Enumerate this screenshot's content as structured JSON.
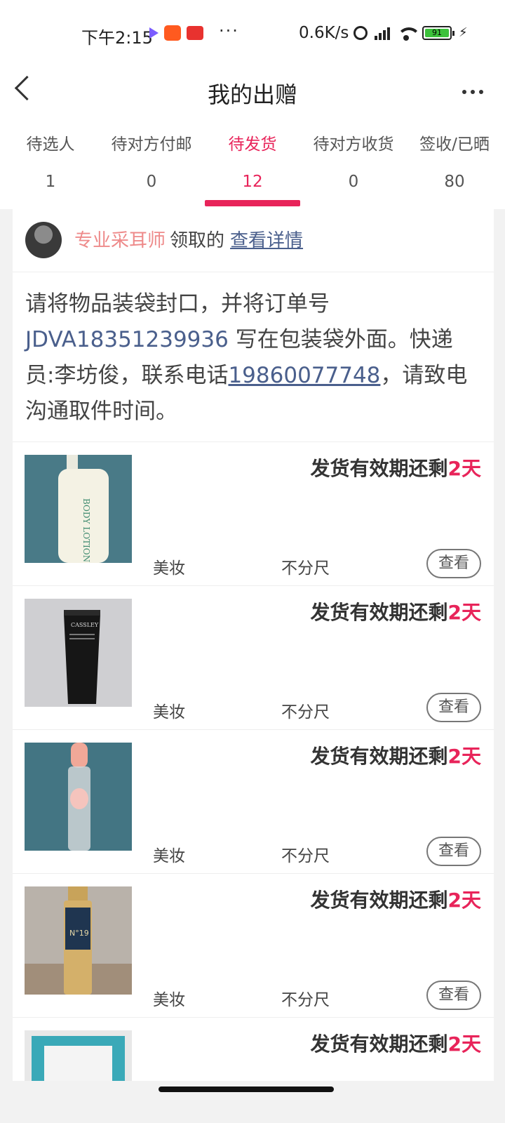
{
  "status_bar": {
    "time": "下午2:15",
    "more": "···",
    "net_speed": "0.6K/s",
    "battery": "91",
    "signal": "HD"
  },
  "nav": {
    "title": "我的出赠"
  },
  "tabs": [
    {
      "label": "待选人",
      "count": "1"
    },
    {
      "label": "待对方付邮",
      "count": "0"
    },
    {
      "label": "待发货",
      "count": "12"
    },
    {
      "label": "待对方收货",
      "count": "0"
    },
    {
      "label": "签收/已晒",
      "count": "80"
    }
  ],
  "active_tab_index": 2,
  "receiver": {
    "name": "专业采耳师",
    "text": "领取的",
    "link": "查看详情"
  },
  "notice": {
    "part1": "请将物品装袋封口，并将订单号 ",
    "order_no": "JDVA18351239936",
    "part2": " 写在包装袋外面。快递员:李坊俊，联系电话",
    "phone": "19860077748",
    "part3": "，请致电沟通取件时间。"
  },
  "items": [
    {
      "deadline_prefix": "发货有效期还剩",
      "days": "2天",
      "category": "美妆",
      "size": "不分尺",
      "button": "查看",
      "image": "body-lotion-bottle"
    },
    {
      "deadline_prefix": "发货有效期还剩",
      "days": "2天",
      "category": "美妆",
      "size": "不分尺",
      "button": "查看",
      "image": "black-hand-cream-tube"
    },
    {
      "deadline_prefix": "发货有效期还剩",
      "days": "2天",
      "category": "美妆",
      "size": "不分尺",
      "button": "查看",
      "image": "pink-cap-bottle"
    },
    {
      "deadline_prefix": "发货有效期还剩",
      "days": "2天",
      "category": "美妆",
      "size": "不分尺",
      "button": "查看",
      "image": "gold-spray-bottle"
    },
    {
      "deadline_prefix": "发货有效期还剩",
      "days": "2天",
      "category": "",
      "size": "",
      "button": "",
      "image": "teal-box"
    }
  ],
  "colors": {
    "accent": "#e8245a",
    "link": "#4a5f8c",
    "receiver_name": "#ee8a8a"
  }
}
